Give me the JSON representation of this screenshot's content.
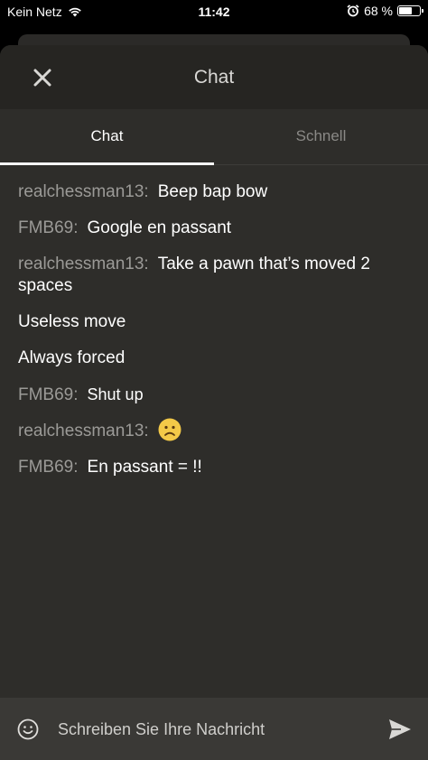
{
  "status_bar": {
    "carrier": "Kein Netz",
    "time": "11:42",
    "battery_text": "68 %",
    "battery_level": 0.68
  },
  "header": {
    "title": "Chat",
    "close_icon": "close-icon"
  },
  "tabs": [
    {
      "label": "Chat",
      "active": true
    },
    {
      "label": "Schnell",
      "active": false
    }
  ],
  "messages": [
    {
      "user": "realchessman13:",
      "text": "Beep bap bow"
    },
    {
      "user": "FMB69:",
      "text": "Google en passant"
    },
    {
      "user": "realchessman13:",
      "text": "Take a pawn that’s moved 2 spaces"
    },
    {
      "user": "",
      "text": "Useless move"
    },
    {
      "user": "",
      "text": "Always forced"
    },
    {
      "user": "FMB69:",
      "text": "Shut up"
    },
    {
      "user": "realchessman13:",
      "text": "",
      "emoji": "frowning-face-emoji"
    },
    {
      "user": "FMB69:",
      "text": "En passant = !!"
    }
  ],
  "composer": {
    "placeholder": "Schreiben Sie Ihre Nachricht",
    "emoji_icon": "smiley-icon",
    "send_icon": "send-icon"
  },
  "colors": {
    "background": "#2e2d2a",
    "header": "#262522",
    "username": "#9b9a97",
    "composer": "#3a3936"
  }
}
